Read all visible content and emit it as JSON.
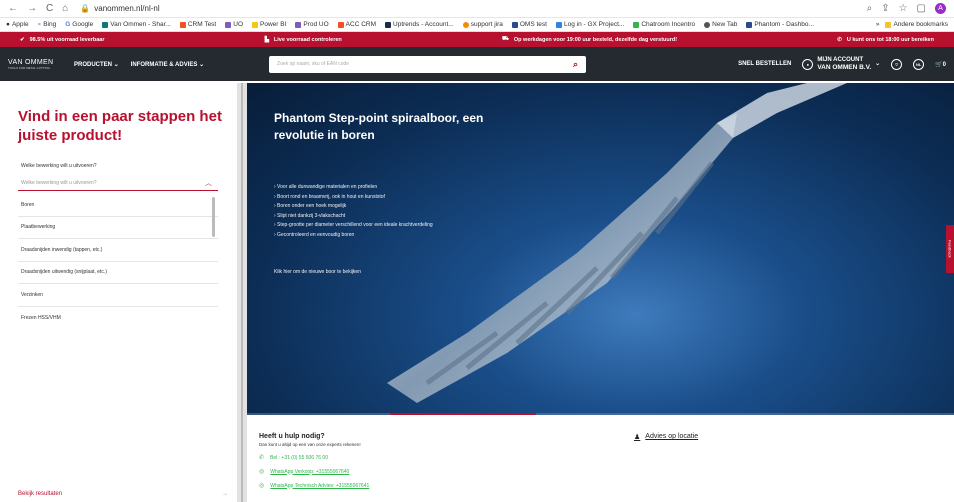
{
  "browser": {
    "url": "vanommen.nl/nl-nl",
    "bookmarks": [
      "Apple",
      "Bing",
      "Google",
      "Van Ommen - Shar...",
      "CRM Test",
      "UO",
      "Power BI",
      "Prod UO",
      "ACC CRM",
      "Uptrends - Account...",
      "support jira",
      "OMS test",
      "Log in - GX Project...",
      "Chatroom Incentro",
      "New Tab",
      "Phantom - Dashbo..."
    ],
    "bookmarks_more": "»",
    "other_bookmarks": "Andere bookmarks",
    "profile_initial": "A"
  },
  "infobar": {
    "item1": "98.5% uit voorraad leverbaar",
    "item2": "Live voorraad controleren",
    "item3": "Op werkdagen voor 19:00 uur besteld, dezelfde dag verstuurd!",
    "item4": "U kunt ons tot 18:00 uur bereiken"
  },
  "nav": {
    "logo_line1": "VAN OMMEN",
    "logo_line2": "TOOLS FOR METAL CUTTING",
    "menu1": "PRODUCTEN",
    "menu2": "INFORMATIE & ADVIES",
    "search_placeholder": "Zoek op naam, sku of EAN code",
    "snel": "SNEL BESTELLEN",
    "account_line1": "MIJN ACCOUNT",
    "account_line2": "VAN OMMEN B.V.",
    "lang": "NL",
    "cart_count": "0"
  },
  "finder": {
    "title": "Vind in een paar stappen het juiste product!",
    "question": "Welke bewerking wilt u uitvoeren?",
    "select_placeholder": "Welke bewerking wilt u uitvoeren?",
    "options": [
      "Boren",
      "Plaatbewerking",
      "Draadsnijden inwendig (tappen, etc.)",
      "Draadsnijden uitwendig (snijplaat, etc.)",
      "Verzinken",
      "Frezen HSS/VHM"
    ],
    "results_label": "Bekijk resultaten",
    "results_arrow": "→"
  },
  "hero": {
    "title": "Phantom Step-point spiraalboor, een revolutie in boren",
    "bullets": [
      "› Voor alle dunwandige materialen en profielen",
      "› Boort rond en braamvrij, ook in hout en kunststof",
      "› Boren onder een hoek mogelijk",
      "› Slipt niet dankzij 3-vlakschacht",
      "› Step-grootte per diameter verschillend voor een ideale krachtverdeling",
      "› Gecontroleerd en eenvoudig boren"
    ],
    "cta": "Klik hier om de nieuwe boor te bekijken"
  },
  "help": {
    "title": "Heeft u hulp nodig?",
    "subtitle": "Dan kunt u altijd op een van onze experts rekenen!",
    "phone": "Bel : +31 (0) 55 506 76 00",
    "wa1": "WhatsApp Verkoop: +31555067640",
    "wa2": "WhatsApp Technisch Advies: +31555067641",
    "advies": "Advies op locatie"
  },
  "feedback_label": "Feedback",
  "colors": {
    "brand": "#b8112f",
    "nav": "#252a30",
    "whatsapp": "#2db64a"
  }
}
